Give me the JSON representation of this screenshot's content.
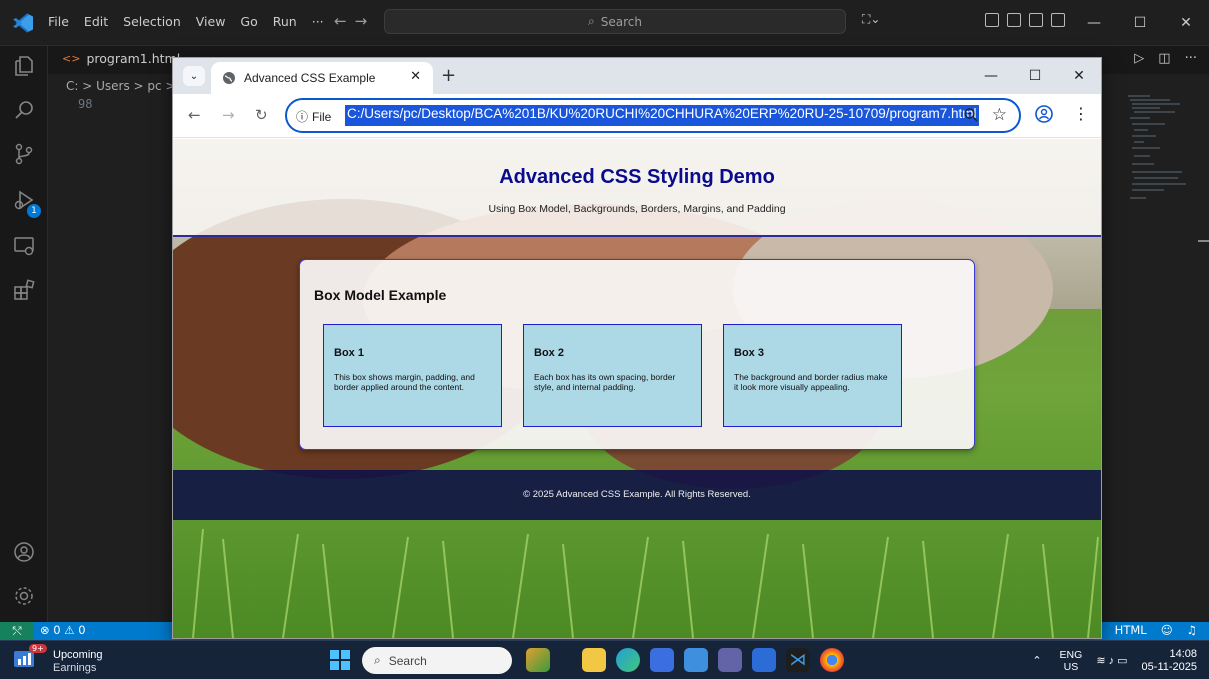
{
  "vscode": {
    "menu": [
      "File",
      "Edit",
      "Selection",
      "View",
      "Go",
      "Run",
      "···"
    ],
    "search_placeholder": "Search",
    "tab_label": "program1.html",
    "breadcrumb": "C: > Users > pc > D",
    "line_number": "98",
    "status_problems": "⊗ 0 ⚠ 0",
    "status_language": "HTML"
  },
  "browser": {
    "tab_title": "Advanced CSS Example",
    "info_label": "File",
    "url": "C:/Users/pc/Desktop/BCA%201B/KU%20RUCHI%20CHHURA%20ERP%20RU-25-10709/program7.html"
  },
  "page": {
    "title": "Advanced CSS Styling Demo",
    "subtitle": "Using Box Model, Backgrounds, Borders, Margins, and Padding",
    "section_title": "Box Model Example",
    "boxes": [
      {
        "title": "Box 1",
        "text": "This box shows margin, padding, and border applied around the content."
      },
      {
        "title": "Box 2",
        "text": "Each box has its own spacing, border style, and internal padding."
      },
      {
        "title": "Box 3",
        "text": "The background and border radius make it look more visually appealing."
      }
    ],
    "footer": "© 2025 Advanced CSS Example. All Rights Reserved."
  },
  "taskbar": {
    "weather_badge": "9+",
    "weather_title": "Upcoming",
    "weather_sub": "Earnings",
    "search_placeholder": "Search",
    "lang_1": "ENG",
    "lang_2": "US",
    "time": "14:08",
    "date": "05-11-2025"
  },
  "colors": {
    "vscode_status": "#007acc",
    "page_title": "#0a0a8c",
    "box_bg": "#add8e6",
    "box_border": "#1f1fcc",
    "footer_bg": "#101246",
    "url_highlight": "#1a56db"
  }
}
